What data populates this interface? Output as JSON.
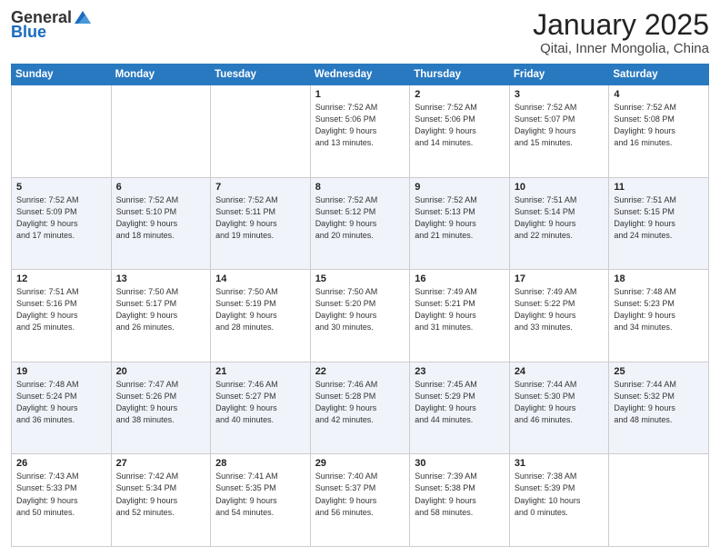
{
  "header": {
    "logo_general": "General",
    "logo_blue": "Blue",
    "title": "January 2025",
    "subtitle": "Qitai, Inner Mongolia, China"
  },
  "weekdays": [
    "Sunday",
    "Monday",
    "Tuesday",
    "Wednesday",
    "Thursday",
    "Friday",
    "Saturday"
  ],
  "weeks": [
    [
      {
        "day": "",
        "info": ""
      },
      {
        "day": "",
        "info": ""
      },
      {
        "day": "",
        "info": ""
      },
      {
        "day": "1",
        "info": "Sunrise: 7:52 AM\nSunset: 5:06 PM\nDaylight: 9 hours\nand 13 minutes."
      },
      {
        "day": "2",
        "info": "Sunrise: 7:52 AM\nSunset: 5:06 PM\nDaylight: 9 hours\nand 14 minutes."
      },
      {
        "day": "3",
        "info": "Sunrise: 7:52 AM\nSunset: 5:07 PM\nDaylight: 9 hours\nand 15 minutes."
      },
      {
        "day": "4",
        "info": "Sunrise: 7:52 AM\nSunset: 5:08 PM\nDaylight: 9 hours\nand 16 minutes."
      }
    ],
    [
      {
        "day": "5",
        "info": "Sunrise: 7:52 AM\nSunset: 5:09 PM\nDaylight: 9 hours\nand 17 minutes."
      },
      {
        "day": "6",
        "info": "Sunrise: 7:52 AM\nSunset: 5:10 PM\nDaylight: 9 hours\nand 18 minutes."
      },
      {
        "day": "7",
        "info": "Sunrise: 7:52 AM\nSunset: 5:11 PM\nDaylight: 9 hours\nand 19 minutes."
      },
      {
        "day": "8",
        "info": "Sunrise: 7:52 AM\nSunset: 5:12 PM\nDaylight: 9 hours\nand 20 minutes."
      },
      {
        "day": "9",
        "info": "Sunrise: 7:52 AM\nSunset: 5:13 PM\nDaylight: 9 hours\nand 21 minutes."
      },
      {
        "day": "10",
        "info": "Sunrise: 7:51 AM\nSunset: 5:14 PM\nDaylight: 9 hours\nand 22 minutes."
      },
      {
        "day": "11",
        "info": "Sunrise: 7:51 AM\nSunset: 5:15 PM\nDaylight: 9 hours\nand 24 minutes."
      }
    ],
    [
      {
        "day": "12",
        "info": "Sunrise: 7:51 AM\nSunset: 5:16 PM\nDaylight: 9 hours\nand 25 minutes."
      },
      {
        "day": "13",
        "info": "Sunrise: 7:50 AM\nSunset: 5:17 PM\nDaylight: 9 hours\nand 26 minutes."
      },
      {
        "day": "14",
        "info": "Sunrise: 7:50 AM\nSunset: 5:19 PM\nDaylight: 9 hours\nand 28 minutes."
      },
      {
        "day": "15",
        "info": "Sunrise: 7:50 AM\nSunset: 5:20 PM\nDaylight: 9 hours\nand 30 minutes."
      },
      {
        "day": "16",
        "info": "Sunrise: 7:49 AM\nSunset: 5:21 PM\nDaylight: 9 hours\nand 31 minutes."
      },
      {
        "day": "17",
        "info": "Sunrise: 7:49 AM\nSunset: 5:22 PM\nDaylight: 9 hours\nand 33 minutes."
      },
      {
        "day": "18",
        "info": "Sunrise: 7:48 AM\nSunset: 5:23 PM\nDaylight: 9 hours\nand 34 minutes."
      }
    ],
    [
      {
        "day": "19",
        "info": "Sunrise: 7:48 AM\nSunset: 5:24 PM\nDaylight: 9 hours\nand 36 minutes."
      },
      {
        "day": "20",
        "info": "Sunrise: 7:47 AM\nSunset: 5:26 PM\nDaylight: 9 hours\nand 38 minutes."
      },
      {
        "day": "21",
        "info": "Sunrise: 7:46 AM\nSunset: 5:27 PM\nDaylight: 9 hours\nand 40 minutes."
      },
      {
        "day": "22",
        "info": "Sunrise: 7:46 AM\nSunset: 5:28 PM\nDaylight: 9 hours\nand 42 minutes."
      },
      {
        "day": "23",
        "info": "Sunrise: 7:45 AM\nSunset: 5:29 PM\nDaylight: 9 hours\nand 44 minutes."
      },
      {
        "day": "24",
        "info": "Sunrise: 7:44 AM\nSunset: 5:30 PM\nDaylight: 9 hours\nand 46 minutes."
      },
      {
        "day": "25",
        "info": "Sunrise: 7:44 AM\nSunset: 5:32 PM\nDaylight: 9 hours\nand 48 minutes."
      }
    ],
    [
      {
        "day": "26",
        "info": "Sunrise: 7:43 AM\nSunset: 5:33 PM\nDaylight: 9 hours\nand 50 minutes."
      },
      {
        "day": "27",
        "info": "Sunrise: 7:42 AM\nSunset: 5:34 PM\nDaylight: 9 hours\nand 52 minutes."
      },
      {
        "day": "28",
        "info": "Sunrise: 7:41 AM\nSunset: 5:35 PM\nDaylight: 9 hours\nand 54 minutes."
      },
      {
        "day": "29",
        "info": "Sunrise: 7:40 AM\nSunset: 5:37 PM\nDaylight: 9 hours\nand 56 minutes."
      },
      {
        "day": "30",
        "info": "Sunrise: 7:39 AM\nSunset: 5:38 PM\nDaylight: 9 hours\nand 58 minutes."
      },
      {
        "day": "31",
        "info": "Sunrise: 7:38 AM\nSunset: 5:39 PM\nDaylight: 10 hours\nand 0 minutes."
      },
      {
        "day": "",
        "info": ""
      }
    ]
  ]
}
